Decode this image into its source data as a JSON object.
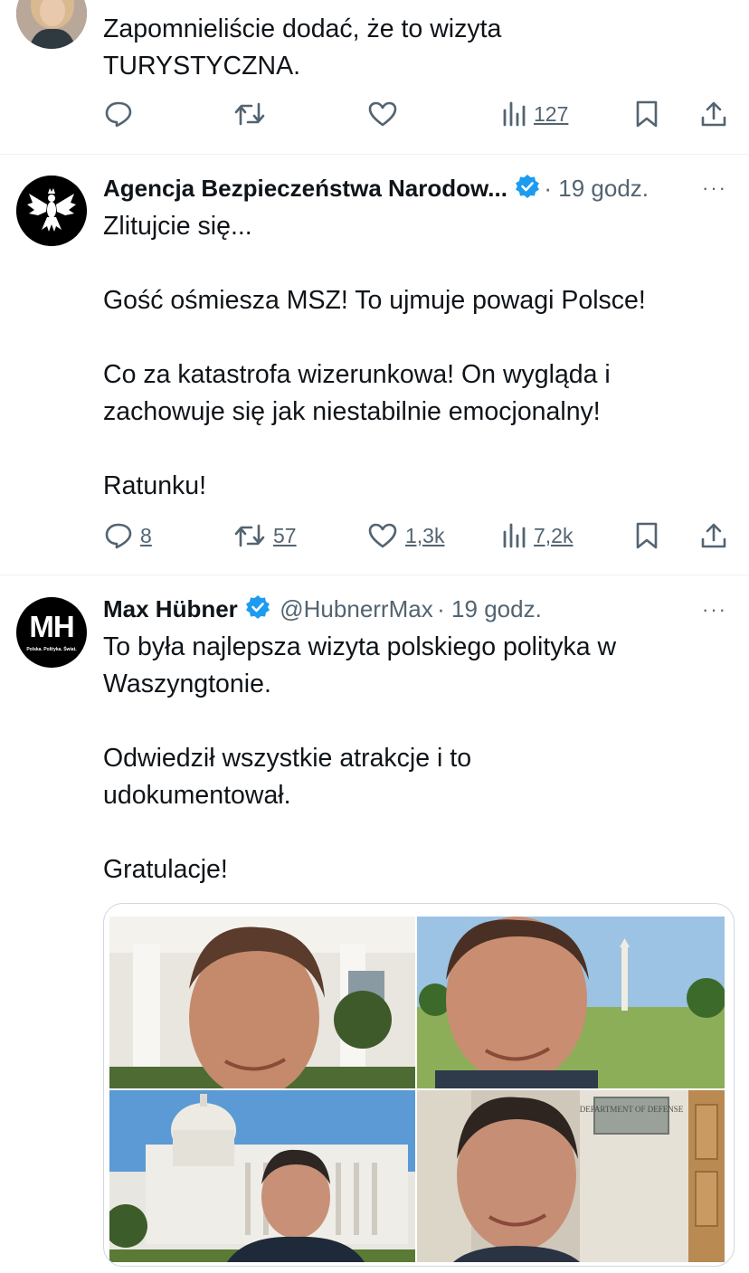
{
  "tweet1": {
    "text_lines": [
      "Zapomnieliście dodać, że to wizyta",
      "TURYSTYCZNA."
    ],
    "actions": {
      "reply": "",
      "retweet": "",
      "like": "",
      "views": "127"
    }
  },
  "tweet2": {
    "author_name": "Agencja Bezpieczeństwa Narodow...",
    "time": "· 19 godz.",
    "more": "···",
    "text_lines": [
      "Zlitujcie się...",
      "",
      "Gość ośmiesza MSZ! To ujmuje powagi Polsce!",
      "",
      "Co za katastrofa wizerunkowa! On wygląda i",
      "zachowuje się jak niestabilnie emocjonalny!",
      "",
      "Ratunku!"
    ],
    "actions": {
      "reply": "8",
      "retweet": "57",
      "like": "1,3k",
      "views": "7,2k"
    }
  },
  "tweet3": {
    "author_name": "Max Hübner",
    "handle": "@HubnerrMax",
    "time": "· 19 godz.",
    "more": "···",
    "avatar_text": "MH",
    "avatar_subtext": "Polska. Polityka. Świat.",
    "text_lines": [
      "To była najlepsza wizyta polskiego polityka w",
      "Waszyngtonie.",
      "",
      "Odwiedził wszystkie atrakcje i to",
      "udokumentował.",
      "",
      "Gratulacje!"
    ],
    "photo_sign": "DEPARTMENT OF DEFENSE"
  },
  "colors": {
    "text": "#0f1419",
    "secondary": "#536471",
    "verified": "#1d9bf0",
    "divider": "#eff3f4"
  }
}
